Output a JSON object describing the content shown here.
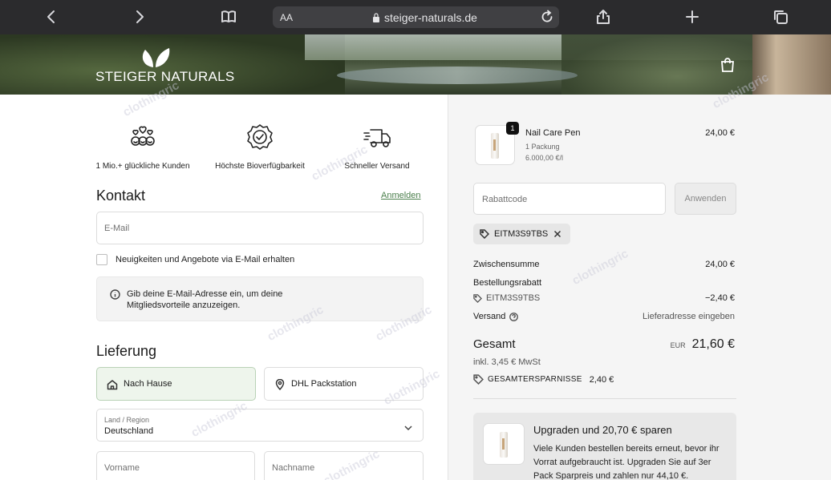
{
  "browser": {
    "aa_label": "AA",
    "url": "steiger-naturals.de"
  },
  "hero": {
    "brand": "STEIGER NATURALS"
  },
  "trust": [
    {
      "icon": "happy-customers-icon",
      "label": "1 Mio.+ glückliche Kunden"
    },
    {
      "icon": "badge-check-icon",
      "label": "Höchste Bioverfügbarkeit"
    },
    {
      "icon": "fast-truck-icon",
      "label": "Schneller Versand"
    }
  ],
  "contact": {
    "title": "Kontakt",
    "login_link": "Anmelden",
    "email_placeholder": "E-Mail",
    "newsletter_label": "Neuigkeiten und Angebote via E-Mail erhalten",
    "info_text": "Gib deine E-Mail-Adresse ein, um deine Mitgliedsvorteile anzuzeigen."
  },
  "delivery": {
    "title": "Lieferung",
    "options": [
      {
        "label": "Nach Hause",
        "selected": true
      },
      {
        "label": "DHL Packstation",
        "selected": false
      }
    ],
    "country_label": "Land / Region",
    "country_value": "Deutschland",
    "first_name_placeholder": "Vorname",
    "last_name_placeholder": "Nachname"
  },
  "summary": {
    "product": {
      "quantity": "1",
      "name": "Nail Care Pen",
      "variant": "1 Packung",
      "unit_price": "6.000,00 €/l",
      "price": "24,00 €"
    },
    "discount_placeholder": "Rabattcode",
    "apply_label": "Anwenden",
    "applied_code": "EITM3S9TBS",
    "subtotal_label": "Zwischensumme",
    "subtotal_value": "24,00 €",
    "order_discount_label": "Bestellungsrabatt",
    "order_discount_code": "EITM3S9TBS",
    "order_discount_value": "−2,40 €",
    "shipping_label": "Versand",
    "shipping_value": "Lieferadresse eingeben",
    "total_label": "Gesamt",
    "total_currency": "EUR",
    "total_value": "21,60 €",
    "tax_note": "inkl. 3,45 € MwSt",
    "savings_label": "GESAMTERSPARNISSE",
    "savings_value": "2,40 €"
  },
  "upsell": {
    "title": "Upgraden und 20,70 € sparen",
    "body": "Viele Kunden bestellen bereits erneut, bevor ihr Vorrat aufgebraucht ist. Upgraden Sie auf 3er Pack Sparpreis und zahlen nur 44,10 €."
  },
  "watermark": "clothingric"
}
